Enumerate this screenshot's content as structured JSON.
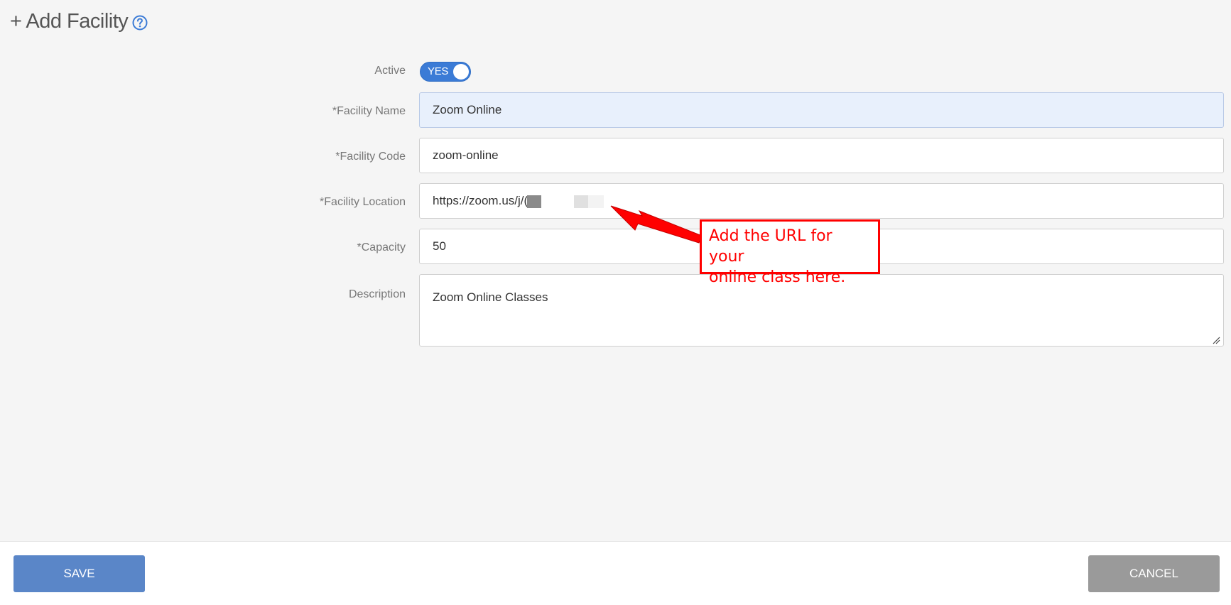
{
  "header": {
    "title": "+ Add Facility",
    "help_icon": "question-circle-icon"
  },
  "form": {
    "active": {
      "label": "Active",
      "toggle_text": "YES",
      "value": true
    },
    "facility_name": {
      "label": "*Facility Name",
      "value": "Zoom Online"
    },
    "facility_code": {
      "label": "*Facility Code",
      "value": "zoom-online"
    },
    "facility_location": {
      "label": "*Facility Location",
      "value": "https://zoom.us/j/("
    },
    "capacity": {
      "label": "*Capacity",
      "value": "50"
    },
    "description": {
      "label": "Description",
      "value": "Zoom Online Classes"
    }
  },
  "annotation": {
    "line1": "Add the URL for your",
    "line2": "online class here.",
    "color": "#ff0000"
  },
  "footer": {
    "save_label": "SAVE",
    "cancel_label": "CANCEL"
  },
  "colors": {
    "accent": "#3b7bd6",
    "save_button": "#5a86c8",
    "cancel_button": "#9a9a9a",
    "highlight_field": "#e8f0fc"
  }
}
